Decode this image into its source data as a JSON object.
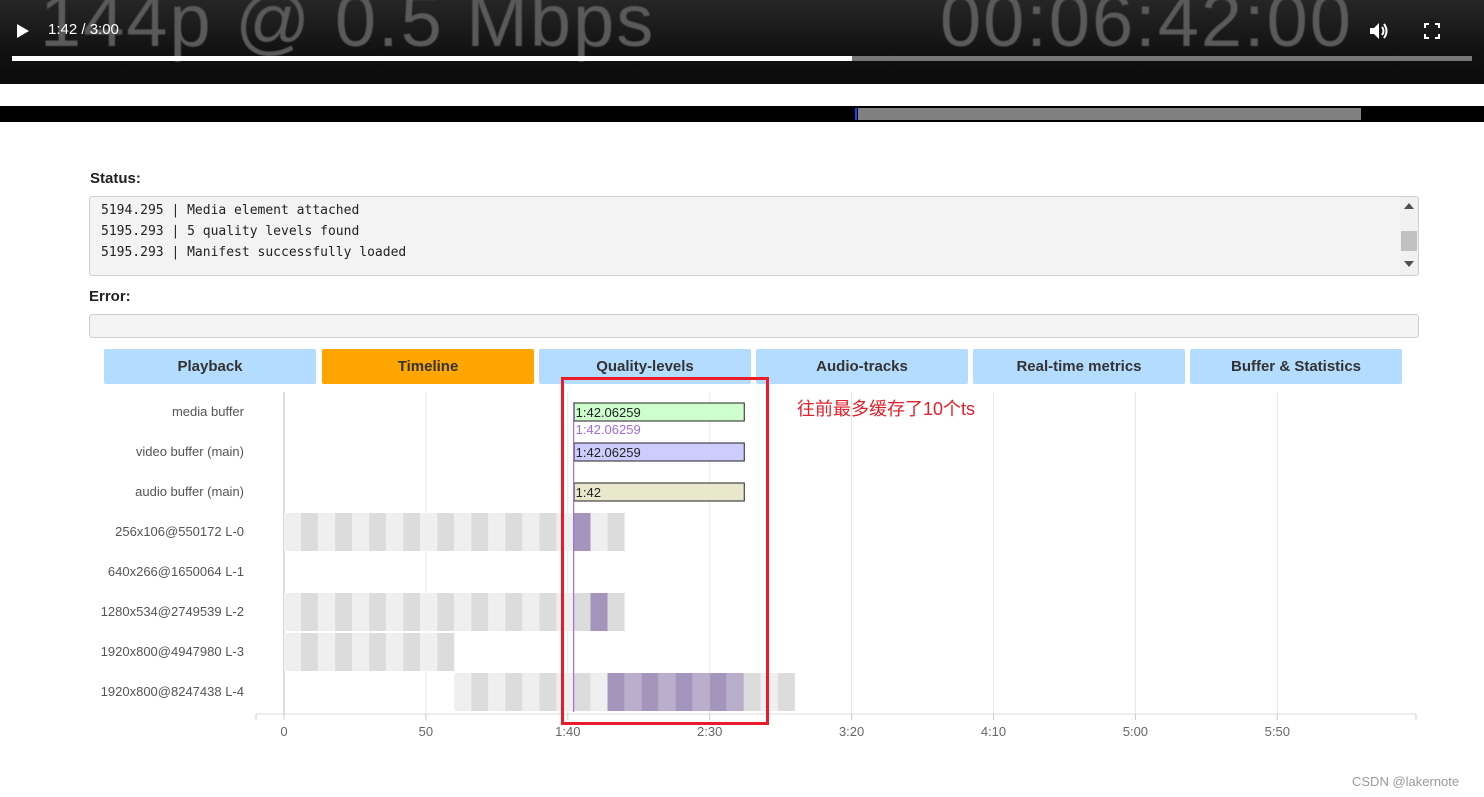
{
  "player": {
    "time_display": "1:42 / 3:00",
    "overlay_left": "144p @ 0.5 Mbps",
    "overlay_right": "00:06:42:00",
    "played_fraction": 0.575
  },
  "buffer_bar": {
    "buffered_start_fraction": 0.578,
    "buffered_end_fraction": 0.917
  },
  "status": {
    "label": "Status:",
    "lines": [
      "5194.295 | Media element attached",
      "5195.293 | 5 quality levels found",
      "5195.293 | Manifest successfully loaded"
    ]
  },
  "error": {
    "label": "Error:",
    "text": ""
  },
  "tabs": [
    {
      "label": "Playback",
      "active": false
    },
    {
      "label": "Timeline",
      "active": true
    },
    {
      "label": "Quality-levels",
      "active": false
    },
    {
      "label": "Audio-tracks",
      "active": false
    },
    {
      "label": "Real-time metrics",
      "active": false
    },
    {
      "label": "Buffer & Statistics",
      "active": false
    }
  ],
  "chart_data": {
    "type": "timeline",
    "x_ticks": [
      "0",
      "50",
      "1:40",
      "2:30",
      "3:20",
      "4:10",
      "5:00",
      "5:50"
    ],
    "x_tick_values": [
      0,
      50,
      100,
      150,
      200,
      250,
      300,
      350
    ],
    "xlim": [
      -10,
      400
    ],
    "current_time": 102.06,
    "current_time_label": "1:42.06259",
    "buffer_rows": [
      {
        "label": "media buffer",
        "start": 102.06,
        "end": 162,
        "text": "1:42.06259",
        "fill": "#ccffcc"
      },
      {
        "label": "video buffer (main)",
        "start": 102.06,
        "end": 162,
        "text": "1:42.06259",
        "fill": "#ccccff"
      },
      {
        "label": "audio buffer (main)",
        "start": 102.06,
        "end": 162,
        "text": "1:42",
        "fill": "#e8e8cc"
      }
    ],
    "level_rows": [
      {
        "label": "256x106@550172 L-0",
        "segments_to": 120,
        "active": [
          [
            102,
            108
          ]
        ]
      },
      {
        "label": "640x266@1650064 L-1",
        "segments_to": 0,
        "active": []
      },
      {
        "label": "1280x534@2749539 L-2",
        "segments_to": 120,
        "active": [
          [
            108,
            114
          ]
        ]
      },
      {
        "label": "1920x800@4947980 L-3",
        "segments_to": 60,
        "active": []
      },
      {
        "label": "1920x800@8247438 L-4",
        "segments_from": 60,
        "segments_to": 180,
        "active": [
          [
            114,
            162
          ]
        ]
      }
    ]
  },
  "annotation": "往前最多缓存了10个ts",
  "watermark": "CSDN @lakernote"
}
